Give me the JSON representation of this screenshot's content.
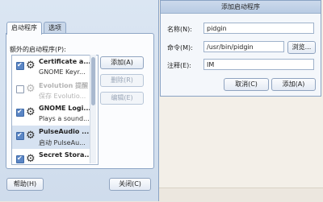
{
  "main_window": {
    "tabs": [
      "启动程序",
      "选项"
    ],
    "list_label": "额外的启动程序(P):",
    "items": [
      {
        "title": "Certificate a...",
        "subtitle": "GNOME Keyr...",
        "checked": true,
        "enabled": true
      },
      {
        "title": "Evolution 提醒",
        "subtitle": "保存 Evolutio...",
        "checked": false,
        "enabled": false
      },
      {
        "title": "GNOME Logi...",
        "subtitle": "Plays a sound...",
        "checked": true,
        "enabled": true
      },
      {
        "title": "PulseAudio ...",
        "subtitle": "启动 PulseAu...",
        "checked": true,
        "enabled": true,
        "selected": true
      },
      {
        "title": "Secret Stora...",
        "subtitle": "",
        "checked": true,
        "enabled": true
      }
    ],
    "buttons": {
      "add": "添加(A)",
      "remove": "删除(R)",
      "edit": "编辑(E)",
      "help": "帮助(H)",
      "close": "关闭(C)"
    }
  },
  "add_dialog": {
    "title": "添加启动程序",
    "name_label": "名称(N):",
    "name_value": "pidgin",
    "command_label": "命令(M):",
    "command_value": "/usr/bin/pidgin",
    "browse_label": "浏览...",
    "comment_label": "注释(E):",
    "comment_value": "IM",
    "cancel_label": "取消(C)",
    "add_label": "添加(A)"
  }
}
